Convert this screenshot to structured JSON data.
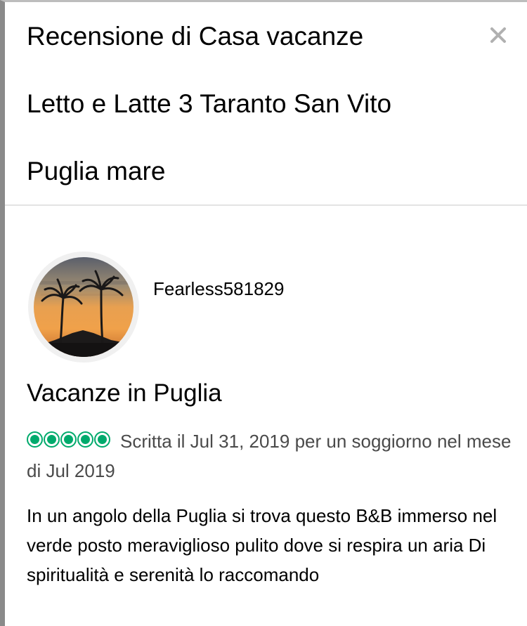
{
  "header": {
    "title_lines": [
      "Recensione di Casa vacanze",
      "Letto e Latte 3 Taranto San Vito",
      "Puglia mare"
    ],
    "close_symbol": "×"
  },
  "review": {
    "username": "Fearless581829",
    "avatar_icon": "avatar-palm-trees-sunset",
    "title": "Vacanze in Puglia",
    "rating": {
      "value": 5,
      "max": 5,
      "color": "#00aa6c"
    },
    "meta": "Scritta il Jul 31, 2019 per un soggiorno nel mese di Jul 2019",
    "body": "In un angolo della Puglia si trova questo B&B immerso nel verde posto meraviglioso pulito dove si respira un aria Di spiritualità e serenità lo raccomando"
  }
}
